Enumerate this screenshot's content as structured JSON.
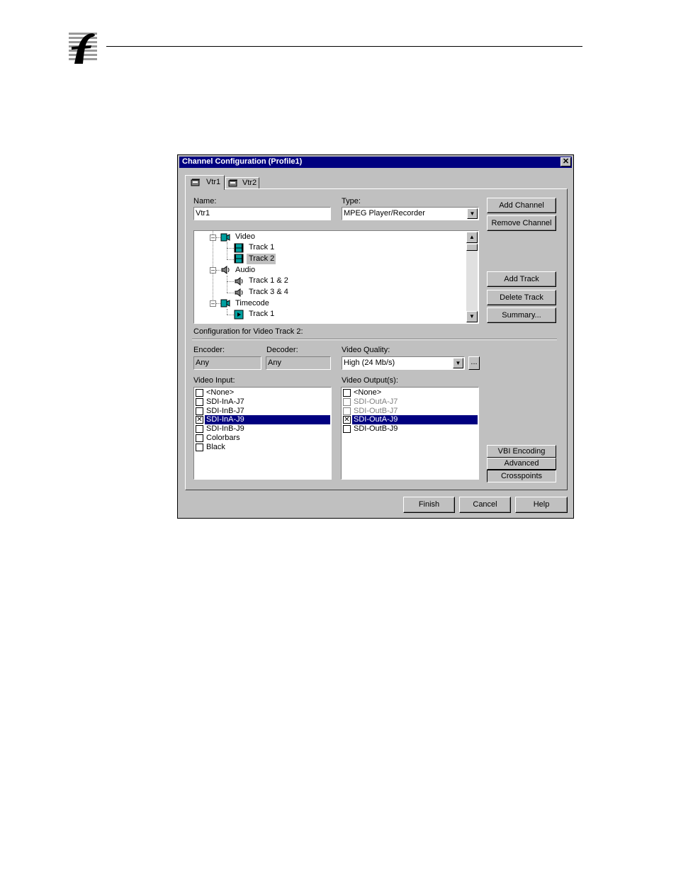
{
  "dialog": {
    "title": "Channel Configuration (Profile1)",
    "close_glyph": "✕"
  },
  "tabs": [
    {
      "label": "Vtr1",
      "icon": "vtr-icon",
      "active": true
    },
    {
      "label": "Vtr2",
      "icon": "vtr-icon",
      "active": false
    }
  ],
  "fields": {
    "name_label": "Name:",
    "name_value": "Vtr1",
    "type_label": "Type:",
    "type_value": "MPEG Player/Recorder"
  },
  "channel_buttons": {
    "add_channel": "Add Channel",
    "remove_channel": "Remove Channel"
  },
  "tree": {
    "nodes": [
      {
        "label": "Video",
        "icon": "video-icon",
        "level": 0
      },
      {
        "label": "Track 1",
        "icon": "film-icon",
        "level": 1
      },
      {
        "label": "Track 2",
        "icon": "film-icon",
        "level": 1,
        "selected": true
      },
      {
        "label": "Audio",
        "icon": "speaker-icon",
        "level": 0
      },
      {
        "label": "Track 1 & 2",
        "icon": "speaker-icon",
        "level": 1
      },
      {
        "label": "Track 3 & 4",
        "icon": "speaker-icon",
        "level": 1
      },
      {
        "label": "Timecode",
        "icon": "timecode-icon",
        "level": 0
      },
      {
        "label": "Track 1",
        "icon": "timecode-track-icon",
        "level": 1
      }
    ]
  },
  "track_buttons": {
    "add_track": "Add Track",
    "delete_track": "Delete Track",
    "summary": "Summary..."
  },
  "config": {
    "heading": "Configuration for Video Track 2:",
    "encoder_label": "Encoder:",
    "encoder_value": "Any",
    "decoder_label": "Decoder:",
    "decoder_value": "Any",
    "quality_label": "Video Quality:",
    "quality_value": "High (24 Mb/s)",
    "ellipsis": "...",
    "input_label": "Video Input:",
    "output_label": "Video Output(s):"
  },
  "video_inputs": [
    {
      "label": "<None>",
      "checked": false,
      "selected": false
    },
    {
      "label": "SDI-InA-J7",
      "checked": false,
      "selected": false
    },
    {
      "label": "SDI-InB-J7",
      "checked": false,
      "selected": false
    },
    {
      "label": "SDI-InA-J9",
      "checked": true,
      "selected": true
    },
    {
      "label": "SDI-InB-J9",
      "checked": false,
      "selected": false
    },
    {
      "label": "Colorbars",
      "checked": false,
      "selected": false
    },
    {
      "label": "Black",
      "checked": false,
      "selected": false
    }
  ],
  "video_outputs": [
    {
      "label": "<None>",
      "checked": false,
      "selected": false,
      "disabled": false
    },
    {
      "label": "SDI-OutA-J7",
      "checked": false,
      "selected": false,
      "disabled": true
    },
    {
      "label": "SDI-OutB-J7",
      "checked": false,
      "selected": false,
      "disabled": true
    },
    {
      "label": "SDI-OutA-J9",
      "checked": true,
      "selected": true,
      "disabled": false
    },
    {
      "label": "SDI-OutB-J9",
      "checked": false,
      "selected": false,
      "disabled": false
    }
  ],
  "side_buttons": {
    "vbi": "VBI Encoding",
    "advanced": "Advanced",
    "crosspoints": "Crosspoints"
  },
  "footer_buttons": {
    "finish": "Finish",
    "cancel": "Cancel",
    "help": "Help"
  },
  "colors": {
    "titlebar": "#000080",
    "selection": "#000080",
    "face": "#c0c0c0"
  }
}
